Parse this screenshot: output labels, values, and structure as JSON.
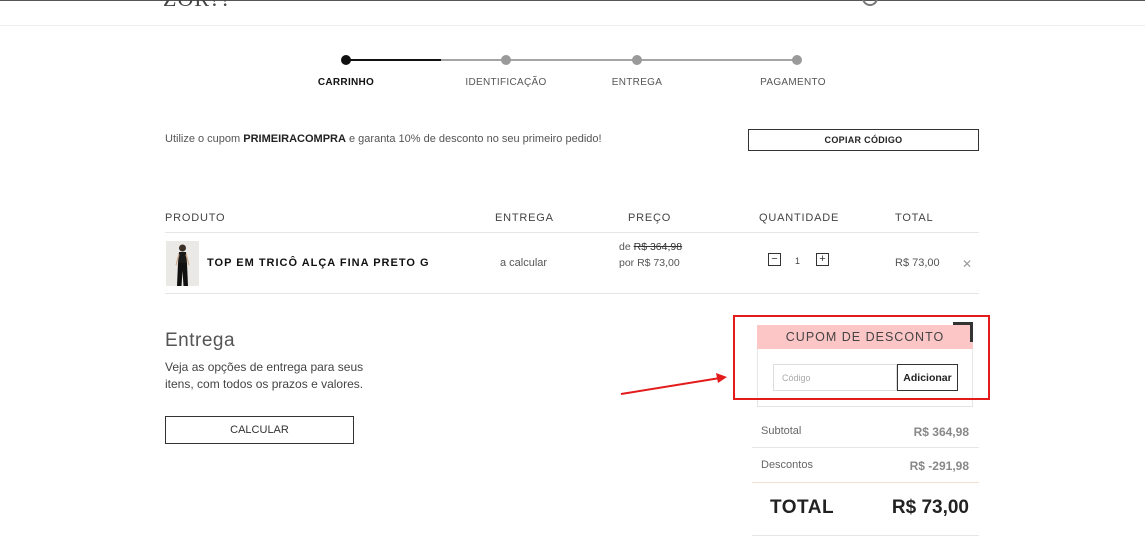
{
  "header": {
    "logo_fragment": "ZOR??"
  },
  "stepper": {
    "steps": [
      {
        "label": "CARRINHO"
      },
      {
        "label": "IDENTIFICAÇÃO"
      },
      {
        "label": "ENTREGA"
      },
      {
        "label": "PAGAMENTO"
      }
    ],
    "active_color": "#111111",
    "inactive_color": "#9a9a9a"
  },
  "promo": {
    "prefix": "Utilize o cupom",
    "code": "PRIMEIRACOMPRA",
    "suffix": "e garanta 10% de desconto no seu primeiro pedido!",
    "copy_button": "COPIAR CÓDIGO"
  },
  "cart_table": {
    "headers": [
      "PRODUTO",
      "ENTREGA",
      "PREÇO",
      "QUANTIDADE",
      "TOTAL"
    ],
    "rows": [
      {
        "name": "TOP EM TRICÔ ALÇA FINA PRETO G",
        "shipping": "a calcular",
        "price_old_prefix": "de",
        "price_old": "R$ 364,98",
        "price_new": "por R$ 73,00",
        "quantity": "1",
        "total": "R$ 73,00",
        "remove_icon": "close-icon"
      }
    ]
  },
  "delivery": {
    "title": "Entrega",
    "description": "Veja as opções de entrega para seus itens, com todos os prazos e valores.",
    "button": "CALCULAR"
  },
  "coupon": {
    "title": "CUPOM DE DESCONTO",
    "placeholder": "Código",
    "button": "Adicionar",
    "header_color": "#fcc5c6",
    "highlight_color": "#e31b1b"
  },
  "summary": {
    "subtotal_label": "Subtotal",
    "subtotal_value": "R$ 364,98",
    "discount_label": "Descontos",
    "discount_value": "R$ -291,98",
    "total_label": "TOTAL",
    "total_value": "R$ 73,00"
  }
}
